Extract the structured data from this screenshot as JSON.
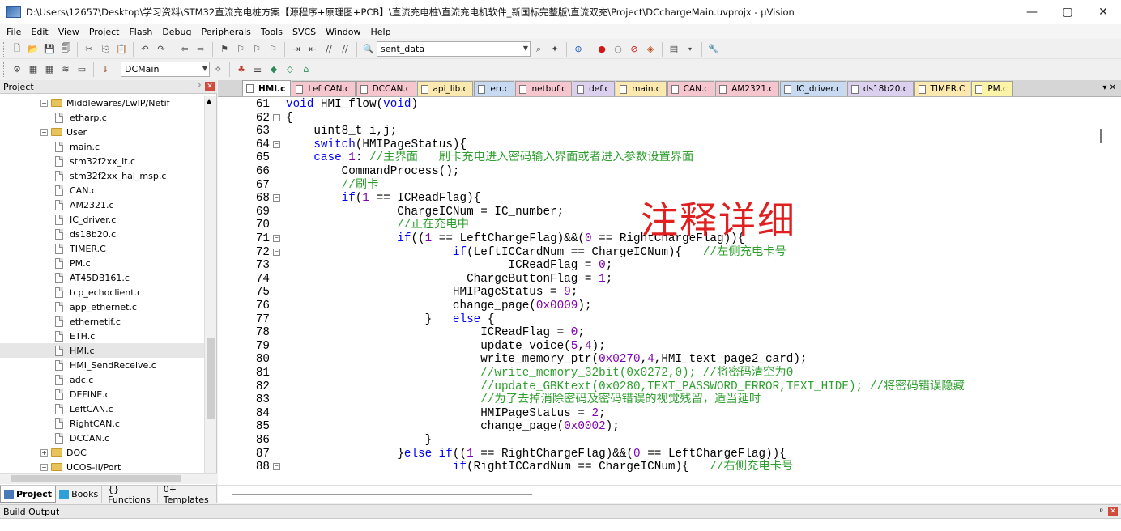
{
  "window": {
    "title": "D:\\Users\\12657\\Desktop\\学习资料\\STM32直流充电桩方案【源程序+原理图+PCB】\\直流充电桩\\直流充电机软件_新国标完整版\\直流双充\\Project\\DCchargeMain.uvprojx - µVision",
    "minimize": "—",
    "maximize": "▢",
    "close": "✕"
  },
  "menu": [
    "File",
    "Edit",
    "View",
    "Project",
    "Flash",
    "Debug",
    "Peripherals",
    "Tools",
    "SVCS",
    "Window",
    "Help"
  ],
  "toolbar1": {
    "find_combo": "sent_data"
  },
  "toolbar2": {
    "target_combo": "DCMain"
  },
  "project_panel": {
    "title": "Project",
    "pin": "ᵖ",
    "close": "✕",
    "tree": [
      {
        "label": "Middlewares/LwIP/Netif",
        "type": "folder",
        "indent": 1,
        "toggle": "−"
      },
      {
        "label": "etharp.c",
        "type": "file",
        "indent": 2
      },
      {
        "label": "User",
        "type": "folder",
        "indent": 1,
        "toggle": "−"
      },
      {
        "label": "main.c",
        "type": "file",
        "indent": 2
      },
      {
        "label": "stm32f2xx_it.c",
        "type": "file",
        "indent": 2
      },
      {
        "label": "stm32f2xx_hal_msp.c",
        "type": "file",
        "indent": 2
      },
      {
        "label": "CAN.c",
        "type": "file",
        "indent": 2
      },
      {
        "label": "AM2321.c",
        "type": "file",
        "indent": 2
      },
      {
        "label": "IC_driver.c",
        "type": "file",
        "indent": 2
      },
      {
        "label": "ds18b20.c",
        "type": "file",
        "indent": 2
      },
      {
        "label": "TIMER.C",
        "type": "file",
        "indent": 2
      },
      {
        "label": "PM.c",
        "type": "file",
        "indent": 2
      },
      {
        "label": "AT45DB161.c",
        "type": "file",
        "indent": 2
      },
      {
        "label": "tcp_echoclient.c",
        "type": "file",
        "indent": 2
      },
      {
        "label": "app_ethernet.c",
        "type": "file",
        "indent": 2
      },
      {
        "label": "ethernetif.c",
        "type": "file",
        "indent": 2
      },
      {
        "label": "ETH.c",
        "type": "file",
        "indent": 2
      },
      {
        "label": "HMI.c",
        "type": "file",
        "indent": 2,
        "selected": true
      },
      {
        "label": "HMI_SendReceive.c",
        "type": "file",
        "indent": 2
      },
      {
        "label": "adc.c",
        "type": "file",
        "indent": 2
      },
      {
        "label": "DEFINE.c",
        "type": "file",
        "indent": 2
      },
      {
        "label": "LeftCAN.c",
        "type": "file",
        "indent": 2
      },
      {
        "label": "RightCAN.c",
        "type": "file",
        "indent": 2
      },
      {
        "label": "DCCAN.c",
        "type": "file",
        "indent": 2
      },
      {
        "label": "DOC",
        "type": "folder",
        "indent": 1,
        "toggle": "+"
      },
      {
        "label": "UCOS-II/Port",
        "type": "folder",
        "indent": 1,
        "toggle": "−"
      }
    ],
    "tabs": [
      "Project",
      "Books",
      "{} Functions",
      "0+ Templates"
    ]
  },
  "editor": {
    "tabs": [
      {
        "label": "HMI.c",
        "color": "#ffffff",
        "active": true
      },
      {
        "label": "LeftCAN.c",
        "color": "#f6c6cf"
      },
      {
        "label": "DCCAN.c",
        "color": "#f6c6cf"
      },
      {
        "label": "api_lib.c",
        "color": "#fbe9b0"
      },
      {
        "label": "err.c",
        "color": "#c8d9f2"
      },
      {
        "label": "netbuf.c",
        "color": "#f6c6cf"
      },
      {
        "label": "def.c",
        "color": "#dcd0ef"
      },
      {
        "label": "main.c",
        "color": "#fbe9b0"
      },
      {
        "label": "CAN.c",
        "color": "#f6c6cf"
      },
      {
        "label": "AM2321.c",
        "color": "#f6c6cf"
      },
      {
        "label": "IC_driver.c",
        "color": "#c8d9f2"
      },
      {
        "label": "ds18b20.c",
        "color": "#dcd0ef"
      },
      {
        "label": "TIMER.C",
        "color": "#fbe9b0"
      },
      {
        "label": "PM.c",
        "color": "#fbf3a8"
      }
    ],
    "tab_controls": "▾ ✕",
    "watermark": "注释详细",
    "lines": [
      {
        "n": "61",
        "fold": "",
        "html": "<span class='kw'>void</span> HMI_flow(<span class='kw'>void</span>)"
      },
      {
        "n": "62",
        "fold": "−",
        "html": "{"
      },
      {
        "n": "63",
        "fold": "",
        "html": "    uint8_t i,j;"
      },
      {
        "n": "64",
        "fold": "−",
        "html": "    <span class='kw'>switch</span>(HMIPageStatus){"
      },
      {
        "n": "65",
        "fold": "",
        "html": "    <span class='kw'>case</span> <span class='num'>1</span>: <span class='cm'>//主界面   刷卡充电进入密码输入界面或者进入参数设置界面</span>"
      },
      {
        "n": "66",
        "fold": "",
        "html": "        CommandProcess();"
      },
      {
        "n": "67",
        "fold": "",
        "html": "        <span class='cm'>//刷卡</span>"
      },
      {
        "n": "68",
        "fold": "−",
        "html": "        <span class='kw'>if</span>(<span class='num'>1</span> == ICReadFlag){"
      },
      {
        "n": "69",
        "fold": "",
        "html": "                ChargeICNum = IC_number;"
      },
      {
        "n": "70",
        "fold": "",
        "html": "                <span class='cm'>//正在充电中</span>"
      },
      {
        "n": "71",
        "fold": "−",
        "html": "                <span class='kw'>if</span>((<span class='num'>1</span> == LeftChargeFlag)&amp;&amp;(<span class='num'>0</span> == RightChargeFlag)){"
      },
      {
        "n": "72",
        "fold": "−",
        "html": "                        <span class='kw'>if</span>(LeftICCardNum == ChargeICNum){   <span class='cm'>//左侧充电卡号</span>"
      },
      {
        "n": "73",
        "fold": "",
        "html": "                                ICReadFlag = <span class='num'>0</span>;"
      },
      {
        "n": "74",
        "fold": "",
        "html": "                          ChargeButtonFlag = <span class='num'>1</span>;"
      },
      {
        "n": "75",
        "fold": "",
        "html": "                        HMIPageStatus = <span class='num'>9</span>;"
      },
      {
        "n": "76",
        "fold": "",
        "html": "                        change_page(<span class='num'>0x0009</span>);"
      },
      {
        "n": "77",
        "fold": "",
        "html": "                    }   <span class='kw'>else</span> {"
      },
      {
        "n": "78",
        "fold": "",
        "html": "                            ICReadFlag = <span class='num'>0</span>;"
      },
      {
        "n": "79",
        "fold": "",
        "html": "                            update_voice(<span class='num'>5</span>,<span class='num'>4</span>);"
      },
      {
        "n": "80",
        "fold": "",
        "html": "                            write_memory_ptr(<span class='num'>0x0270</span>,<span class='num'>4</span>,HMI_text_page2_card);"
      },
      {
        "n": "81",
        "fold": "",
        "html": "                            <span class='cm'>//write_memory_32bit(0x0272,0); //将密码清空为0</span>"
      },
      {
        "n": "82",
        "fold": "",
        "html": "                            <span class='cm'>//update_GBKtext(0x0280,TEXT_PASSWORD_ERROR,TEXT_HIDE); //将密码错误隐藏</span>"
      },
      {
        "n": "83",
        "fold": "",
        "html": "                            <span class='cm'>//为了去掉消除密码及密码错误的视觉残留，适当延时</span>"
      },
      {
        "n": "84",
        "fold": "",
        "html": "                            HMIPageStatus = <span class='num'>2</span>;"
      },
      {
        "n": "85",
        "fold": "",
        "html": "                            change_page(<span class='num'>0x0002</span>);"
      },
      {
        "n": "86",
        "fold": "",
        "html": "                    }"
      },
      {
        "n": "87",
        "fold": "",
        "html": "                }<span class='kw'>else if</span>((<span class='num'>1</span> == RightChargeFlag)&amp;&amp;(<span class='num'>0</span> == LeftChargeFlag)){"
      },
      {
        "n": "88",
        "fold": "−",
        "html": "                        <span class='kw'>if</span>(RightICCardNum == ChargeICNum){   <span class='cm'>//右侧充电卡号</span>"
      }
    ]
  },
  "build_output": {
    "title": "Build Output",
    "pin": "ᵖ",
    "close": "✕"
  }
}
